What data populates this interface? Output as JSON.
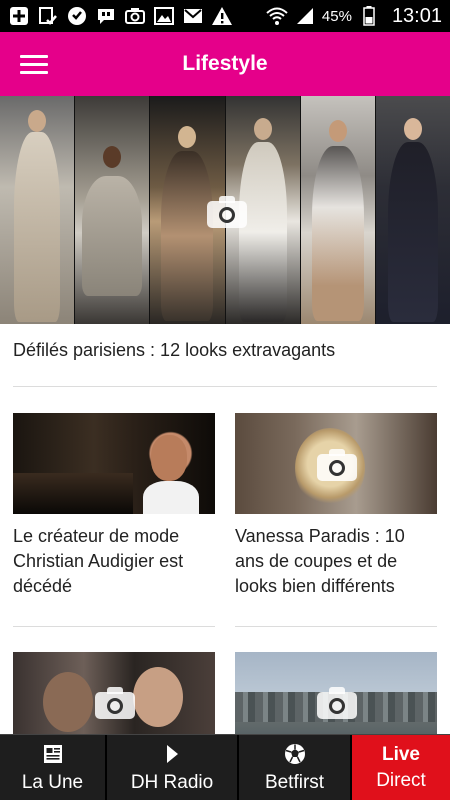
{
  "status_bar": {
    "battery": "45%",
    "time": "13:01",
    "left_icons": [
      "add-icon",
      "download-check-icon",
      "heart-bubble-icon",
      "quote-bubble-icon",
      "camera-icon",
      "image-icon",
      "mail-icon",
      "warning-icon"
    ],
    "right_icons": [
      "wifi-icon",
      "signal-icon",
      "battery-icon"
    ]
  },
  "app_bar": {
    "title": "Lifestyle",
    "menu_icon": "hamburger-menu-icon",
    "color": "#e5008a"
  },
  "articles": {
    "hero": {
      "title": "Défilés parisiens : 12 looks extravagants",
      "has_gallery": true
    },
    "cards": [
      {
        "title": "Le créateur de mode Christian Audigier est décédé",
        "has_gallery": false
      },
      {
        "title": "Vanessa Paradis : 10 ans de coupes et de looks bien différents",
        "has_gallery": true
      },
      {
        "title": "",
        "has_gallery": true
      },
      {
        "title": "",
        "has_gallery": true
      }
    ]
  },
  "bottom_nav": {
    "items": [
      {
        "label": "La Une",
        "icon": "newspaper-icon"
      },
      {
        "label": "DH Radio",
        "icon": "play-icon"
      },
      {
        "label": "Betfirst",
        "icon": "soccer-ball-icon"
      },
      {
        "top": "Live",
        "label": "Direct",
        "icon": ""
      }
    ],
    "live_color": "#e0101b"
  }
}
